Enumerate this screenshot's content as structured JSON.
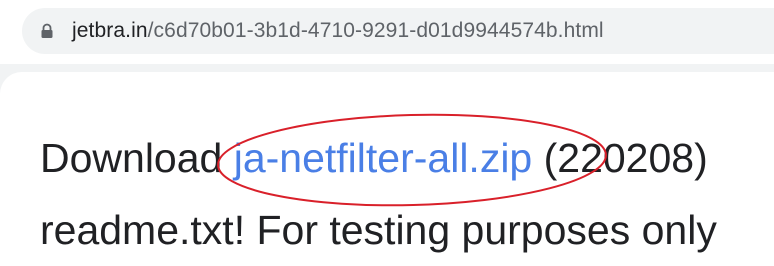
{
  "address_bar": {
    "host": "jetbra.in",
    "path": "/c6d70b01-3b1d-4710-9291-d01d9944574b.html"
  },
  "content": {
    "line1_prefix": "Download ",
    "link_text": "ja-netfilter-all.zip",
    "line1_suffix": " (220208)",
    "line2": "readme.txt! For testing purposes only"
  },
  "colors": {
    "link": "#4a7fe6",
    "annotation_ellipse": "#d9202a"
  },
  "icons": [
    "lock-icon"
  ]
}
